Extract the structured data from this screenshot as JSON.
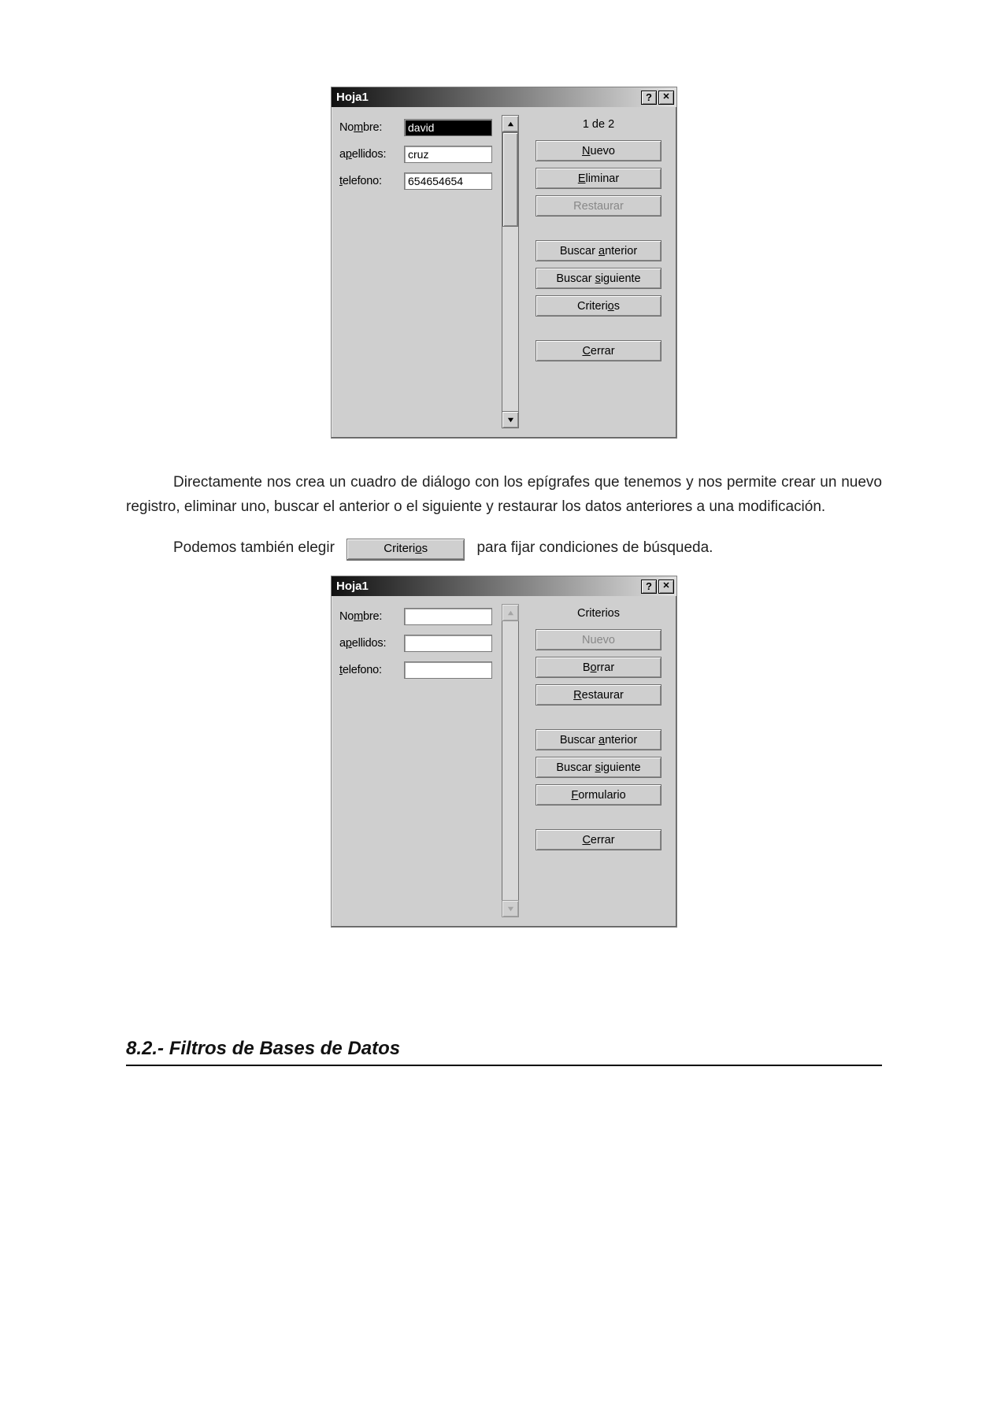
{
  "dialog1": {
    "title": "Hoja1",
    "counter": "1 de 2",
    "fields": {
      "nombre": {
        "label_pre": "No",
        "label_u": "m",
        "label_post": "bre:",
        "value": "david",
        "selected": true
      },
      "apellidos": {
        "label_pre": "a",
        "label_u": "p",
        "label_post": "ellidos:",
        "value": "cruz",
        "selected": false
      },
      "telefono": {
        "label_pre": "",
        "label_u": "t",
        "label_post": "elefono:",
        "value": "654654654",
        "selected": false
      }
    },
    "buttons": {
      "nuevo": {
        "u": "N",
        "post": "uevo",
        "disabled": false
      },
      "eliminar": {
        "u": "E",
        "post": "liminar",
        "disabled": false
      },
      "restaurar": {
        "pre": "Restaurar",
        "disabled": true
      },
      "buscar_ant": {
        "pre": "Buscar ",
        "u": "a",
        "post": "nterior"
      },
      "buscar_sig": {
        "pre": "Buscar ",
        "u": "s",
        "post": "iguiente"
      },
      "criterios": {
        "pre": "Criteri",
        "u": "o",
        "post": "s"
      },
      "cerrar": {
        "u": "C",
        "post": "errar"
      }
    }
  },
  "text": {
    "para1": "Directamente nos crea un cuadro de diálogo con los epígrafes que tenemos y nos permite crear un nuevo registro, eliminar uno, buscar el anterior o el siguiente y restaurar los datos anteriores a una modificación.",
    "para2_pre": "Podemos  también  elegir",
    "para2_post": "para  fijar  condiciones  de búsqueda.",
    "inline_btn_pre": "Criteri",
    "inline_btn_u": "o",
    "inline_btn_post": "s"
  },
  "dialog2": {
    "title": "Hoja1",
    "counter": "Criterios",
    "fields": {
      "nombre": {
        "label_pre": "No",
        "label_u": "m",
        "label_post": "bre:",
        "value": ""
      },
      "apellidos": {
        "label_pre": "a",
        "label_u": "p",
        "label_post": "ellidos:",
        "value": ""
      },
      "telefono": {
        "label_pre": "",
        "label_u": "t",
        "label_post": "elefono:",
        "value": ""
      }
    },
    "buttons": {
      "nuevo": {
        "pre": "Nuevo",
        "disabled": true
      },
      "borrar": {
        "pre": "B",
        "u": "o",
        "post": "rrar"
      },
      "restaurar": {
        "u": "R",
        "post": "estaurar"
      },
      "buscar_ant": {
        "pre": "Buscar ",
        "u": "a",
        "post": "nterior"
      },
      "buscar_sig": {
        "pre": "Buscar ",
        "u": "s",
        "post": "iguiente"
      },
      "formulario": {
        "u": "F",
        "post": "ormulario"
      },
      "cerrar": {
        "u": "C",
        "post": "errar"
      }
    }
  },
  "heading": "8.2.- Filtros de Bases de Datos"
}
